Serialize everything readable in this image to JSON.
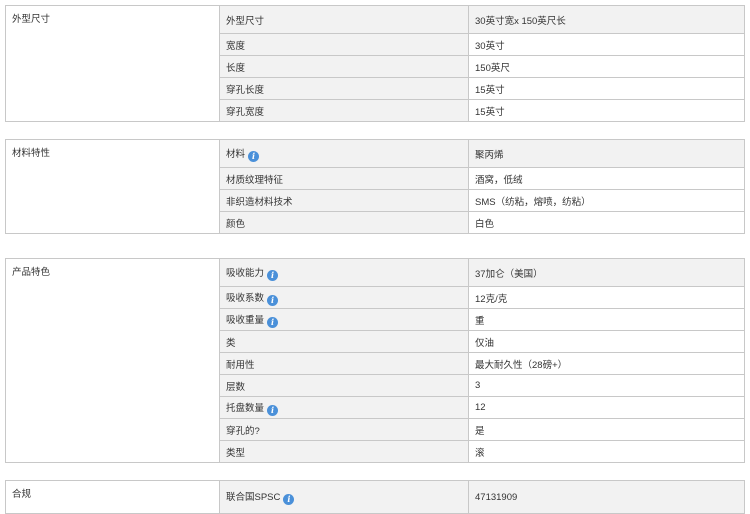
{
  "sections": [
    {
      "category": "外型尺寸",
      "rows": [
        {
          "name": "外型尺寸",
          "value": "30英寸宽x 150英尺长"
        },
        {
          "name": "宽度",
          "value": "30英寸"
        },
        {
          "name": "长度",
          "value": "150英尺"
        },
        {
          "name": "穿孔长度",
          "value": "15英寸"
        },
        {
          "name": "穿孔宽度",
          "value": "15英寸"
        }
      ]
    },
    {
      "category": "材料特性",
      "rows": [
        {
          "name": "材料",
          "value": "聚丙烯",
          "info": true
        },
        {
          "name": "材质纹理特征",
          "value": "酒窝，低绒"
        },
        {
          "name": "非织造材料技术",
          "value": "SMS（纺粘，熔喷，纺粘）"
        },
        {
          "name": "颜色",
          "value": "白色"
        }
      ]
    },
    {
      "category": "产品特色",
      "rows": [
        {
          "name": "吸收能力",
          "value": "37加仑（美国）",
          "info": true
        },
        {
          "name": "吸收系数",
          "value": "12克/克",
          "info": true
        },
        {
          "name": "吸收重量",
          "value": "重",
          "info": true
        },
        {
          "name": "类",
          "value": "仅油"
        },
        {
          "name": "耐用性",
          "value": "最大耐久性（28磅+）"
        },
        {
          "name": "层数",
          "value": "3"
        },
        {
          "name": "托盘数量",
          "value": "12",
          "info": true
        },
        {
          "name": "穿孔的?",
          "value": "是"
        },
        {
          "name": "类型",
          "value": "滚"
        }
      ]
    },
    {
      "category": "合规",
      "rows": [
        {
          "name": "联合国SPSC",
          "value": "47131909",
          "info": true
        }
      ]
    }
  ],
  "info_icon": {
    "glyph": "i",
    "name": "info-icon",
    "color": "#4a90d9"
  }
}
